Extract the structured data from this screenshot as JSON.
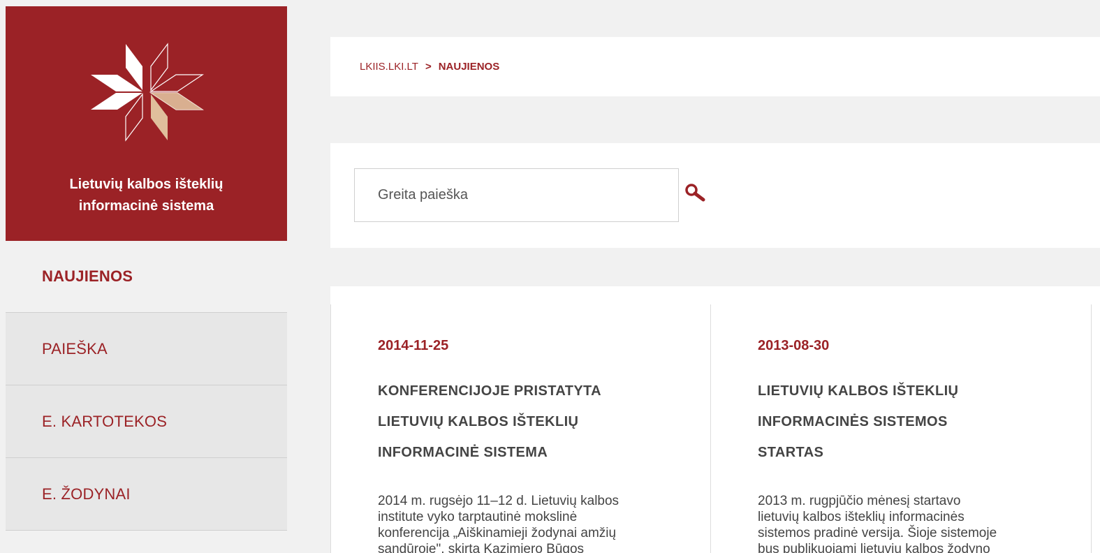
{
  "brand": {
    "title_line1": "Lietuvių kalbos išteklių",
    "title_line2": "informacinė sistema",
    "colors": {
      "primary": "#9b2226",
      "logo_light": "#ffffff",
      "logo_accent": "#e0bf9c"
    }
  },
  "nav": {
    "items": [
      {
        "label": "NAUJIENOS",
        "active": true
      },
      {
        "label": "PAIEŠKA",
        "active": false
      },
      {
        "label": "E. KARTOTEKOS",
        "active": false
      },
      {
        "label": "E. ŽODYNAI",
        "active": false
      }
    ]
  },
  "breadcrumb": {
    "root": "LKIIS.LKI.LT",
    "separator": ">",
    "current": "NAUJIENOS"
  },
  "search": {
    "placeholder": "Greita paieška",
    "icon": "search-icon"
  },
  "news": [
    {
      "date": "2014-11-25",
      "title_line1": "KONFERENCIJOJE PRISTATYTA",
      "title_line2": "LIETUVIŲ KALBOS IŠTEKLIŲ",
      "title_line3": "INFORMACINĖ SISTEMA",
      "body_line1": "2014 m. rugsėjo 11–12 d. Lietuvių kalbos",
      "body_line2": "institute vyko tarptautinė mokslinė",
      "body_line3": "konferencija „Aiškinamieji žodynai amžių",
      "body_line4": "sandūroje\", skirta Kazimiero Būgos"
    },
    {
      "date": "2013-08-30",
      "title_line1": "LIETUVIŲ KALBOS IŠTEKLIŲ",
      "title_line2": "INFORMACINĖS SISTEMOS",
      "title_line3": "STARTAS",
      "body_line1": "2013 m. rugpjūčio mėnesį startavo",
      "body_line2": "lietuvių kalbos išteklių informacinės",
      "body_line3": "sistemos pradinė versija.  Šioje sistemoje",
      "body_line4": "bus publikuojami lietuvių kalbos žodyno"
    }
  ]
}
